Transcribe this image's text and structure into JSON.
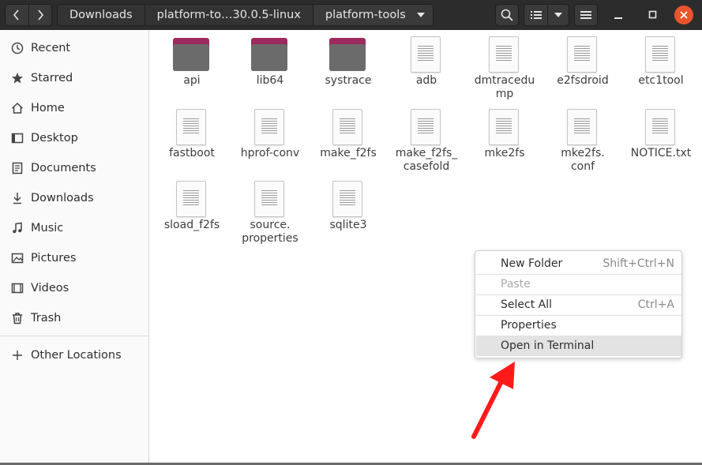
{
  "header": {
    "breadcrumbs": [
      "Downloads",
      "platform-to…30.0.5-linux",
      "platform-tools"
    ],
    "colors": {
      "bar": "#2c2c2c",
      "close": "#e9542b"
    }
  },
  "sidebar": {
    "items": [
      {
        "label": "Recent",
        "icon": "clock-icon"
      },
      {
        "label": "Starred",
        "icon": "star-icon"
      },
      {
        "label": "Home",
        "icon": "home-icon"
      },
      {
        "label": "Desktop",
        "icon": "desktop-icon"
      },
      {
        "label": "Documents",
        "icon": "document-icon"
      },
      {
        "label": "Downloads",
        "icon": "download-icon"
      },
      {
        "label": "Music",
        "icon": "music-icon"
      },
      {
        "label": "Pictures",
        "icon": "picture-icon"
      },
      {
        "label": "Videos",
        "icon": "video-icon"
      },
      {
        "label": "Trash",
        "icon": "trash-icon"
      }
    ],
    "other_locations": {
      "label": "Other Locations",
      "icon": "plus-icon"
    }
  },
  "files": [
    {
      "name": "api",
      "type": "folder"
    },
    {
      "name": "lib64",
      "type": "folder"
    },
    {
      "name": "systrace",
      "type": "folder"
    },
    {
      "name": "adb",
      "type": "file"
    },
    {
      "name": "dmtracedump",
      "type": "file"
    },
    {
      "name": "e2fsdroid",
      "type": "file"
    },
    {
      "name": "etc1tool",
      "type": "file"
    },
    {
      "name": "fastboot",
      "type": "file"
    },
    {
      "name": "hprof-conv",
      "type": "file"
    },
    {
      "name": "make_f2fs",
      "type": "file"
    },
    {
      "name": "make_f2fs_casefold",
      "type": "file"
    },
    {
      "name": "mke2fs",
      "type": "file"
    },
    {
      "name": "mke2fs.conf",
      "type": "file"
    },
    {
      "name": "NOTICE.txt",
      "type": "file"
    },
    {
      "name": "sload_f2fs",
      "type": "file"
    },
    {
      "name": "source.properties",
      "type": "file"
    },
    {
      "name": "sqlite3",
      "type": "file"
    }
  ],
  "file_name_lines": {
    "dmtracedump": [
      "dmtracedu",
      "mp"
    ],
    "make_f2fs_casefold": [
      "make_f2fs_",
      "casefold"
    ],
    "mke2fs.conf": [
      "mke2fs.",
      "conf"
    ],
    "source.properties": [
      "source.",
      "properties"
    ]
  },
  "context_menu": {
    "items": [
      {
        "label": "New Folder",
        "accel": "Shift+Ctrl+N",
        "enabled": true
      },
      {
        "label": "Paste",
        "accel": "",
        "enabled": false
      },
      {
        "label": "Select All",
        "accel": "Ctrl+A",
        "enabled": true
      },
      {
        "label": "Properties",
        "accel": "",
        "enabled": true
      },
      {
        "label": "Open in Terminal",
        "accel": "",
        "enabled": true,
        "highlighted": true
      }
    ]
  },
  "annotation": {
    "icon": "red-arrow-icon",
    "color": "#ff1a1a"
  }
}
